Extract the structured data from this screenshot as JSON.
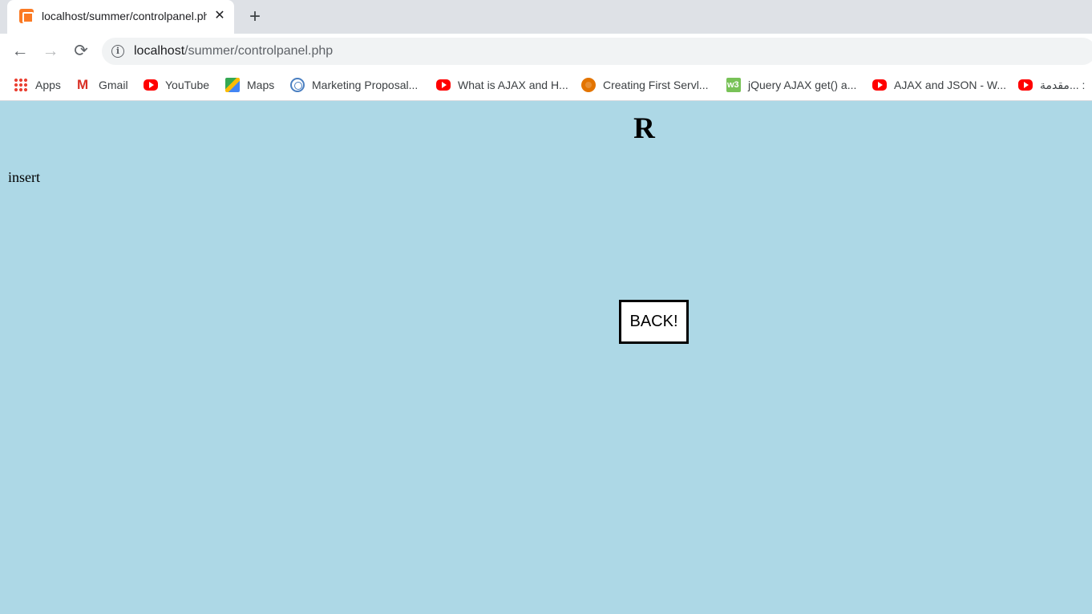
{
  "browser": {
    "tab": {
      "title": "localhost/summer/controlpanel.php",
      "close_label": "✕",
      "favicon": "xampp-icon"
    },
    "new_tab_label": "+",
    "nav": {
      "back": "←",
      "forward": "→",
      "reload": "⟳"
    },
    "address": {
      "host": "localhost",
      "path": "/summer/controlpanel.php",
      "info_icon": "i"
    },
    "bookmarks": [
      {
        "label": "Apps",
        "icon": "apps-icon"
      },
      {
        "label": "Gmail",
        "icon": "gmail-icon"
      },
      {
        "label": "YouTube",
        "icon": "youtube-icon"
      },
      {
        "label": "Maps",
        "icon": "maps-icon"
      },
      {
        "label": "Marketing Proposal...",
        "icon": "marketing-icon"
      },
      {
        "label": "What is AJAX and H...",
        "icon": "youtube-icon"
      },
      {
        "label": "Creating First Servl...",
        "icon": "servlet-icon"
      },
      {
        "label": "jQuery AJAX get() a...",
        "icon": "w3schools-icon"
      },
      {
        "label": "AJAX and JSON - W...",
        "icon": "youtube-icon"
      },
      {
        "label": "مقدمة... :",
        "icon": "youtube-icon"
      }
    ]
  },
  "page": {
    "heading": "R",
    "insert_text": "insert",
    "back_button_label": "BACK!",
    "background_color": "#add8e6"
  }
}
